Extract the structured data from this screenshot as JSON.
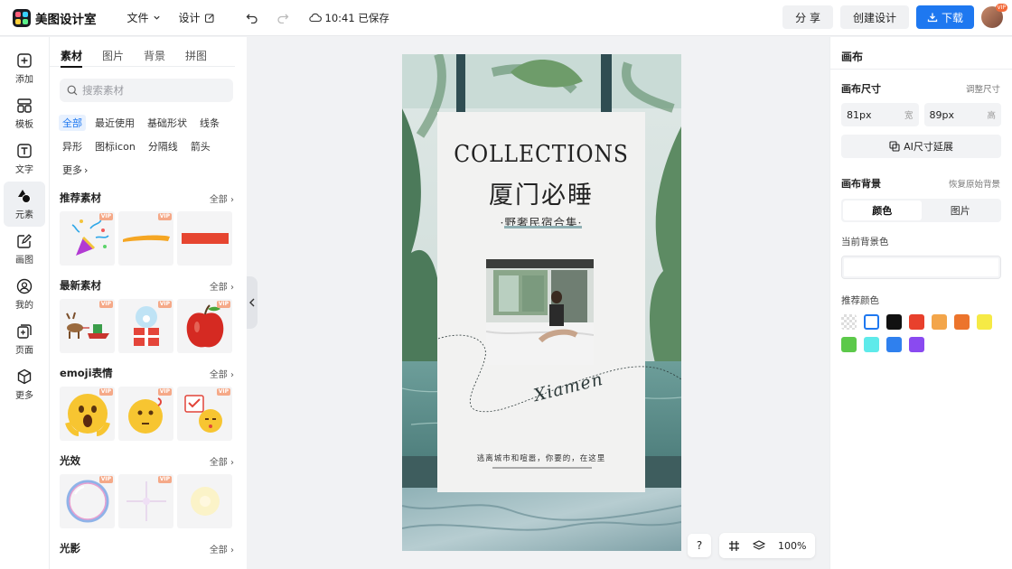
{
  "app": {
    "name": "美图设计室"
  },
  "menu": {
    "file": "文件",
    "design": "设计",
    "saved": "10:41 已保存"
  },
  "actions": {
    "share": "分 享",
    "create": "创建设计",
    "download": "下载",
    "avatar_badge": "VIP"
  },
  "nav": [
    {
      "label": "添加",
      "icon": "plus-square-icon"
    },
    {
      "label": "模板",
      "icon": "template-icon"
    },
    {
      "label": "文字",
      "icon": "text-icon"
    },
    {
      "label": "元素",
      "icon": "shapes-icon"
    },
    {
      "label": "画图",
      "icon": "pencil-icon"
    },
    {
      "label": "我的",
      "icon": "user-icon"
    },
    {
      "label": "页面",
      "icon": "page-add-icon"
    },
    {
      "label": "更多",
      "icon": "cube-icon"
    }
  ],
  "panel": {
    "tabs": [
      "素材",
      "图片",
      "背景",
      "拼图"
    ],
    "search_placeholder": "搜索素材",
    "chips": [
      "全部",
      "最近使用",
      "基础形状",
      "线条",
      "异形",
      "图标icon",
      "分隔线",
      "箭头",
      "更多"
    ],
    "vip": "VIP",
    "all_label": "全部",
    "sections": [
      "推荐素材",
      "最新素材",
      "emoji表情",
      "光效",
      "光影"
    ]
  },
  "poster": {
    "title_en": "COLLECTIONS",
    "title_cn": "厦门必睡",
    "subtitle": "·野奢民宿合集·",
    "signature": "Xiamen",
    "bottom_text": "逃离城市和喧嚣，你要的，在这里"
  },
  "zoom": {
    "help": "?",
    "level": "100%"
  },
  "right": {
    "title": "画布",
    "size_label": "画布尺寸",
    "adjust_size": "调整尺寸",
    "width_value": "81px",
    "width_unit": "宽",
    "height_value": "89px",
    "height_unit": "高",
    "ai_extend": "AI尺寸延展",
    "bg_label": "画布背景",
    "restore_bg": "恢复原始背景",
    "seg_color": "颜色",
    "seg_image": "图片",
    "current_bg": "当前背景色",
    "recommended": "推荐颜色",
    "colors": [
      "transparent",
      "#ffffff",
      "#111111",
      "#e8402c",
      "#f3a54a",
      "#ec742c",
      "#f6ea45",
      "#5cc94a",
      "#5eeaea",
      "#2f80ee",
      "#8a4af0"
    ]
  }
}
